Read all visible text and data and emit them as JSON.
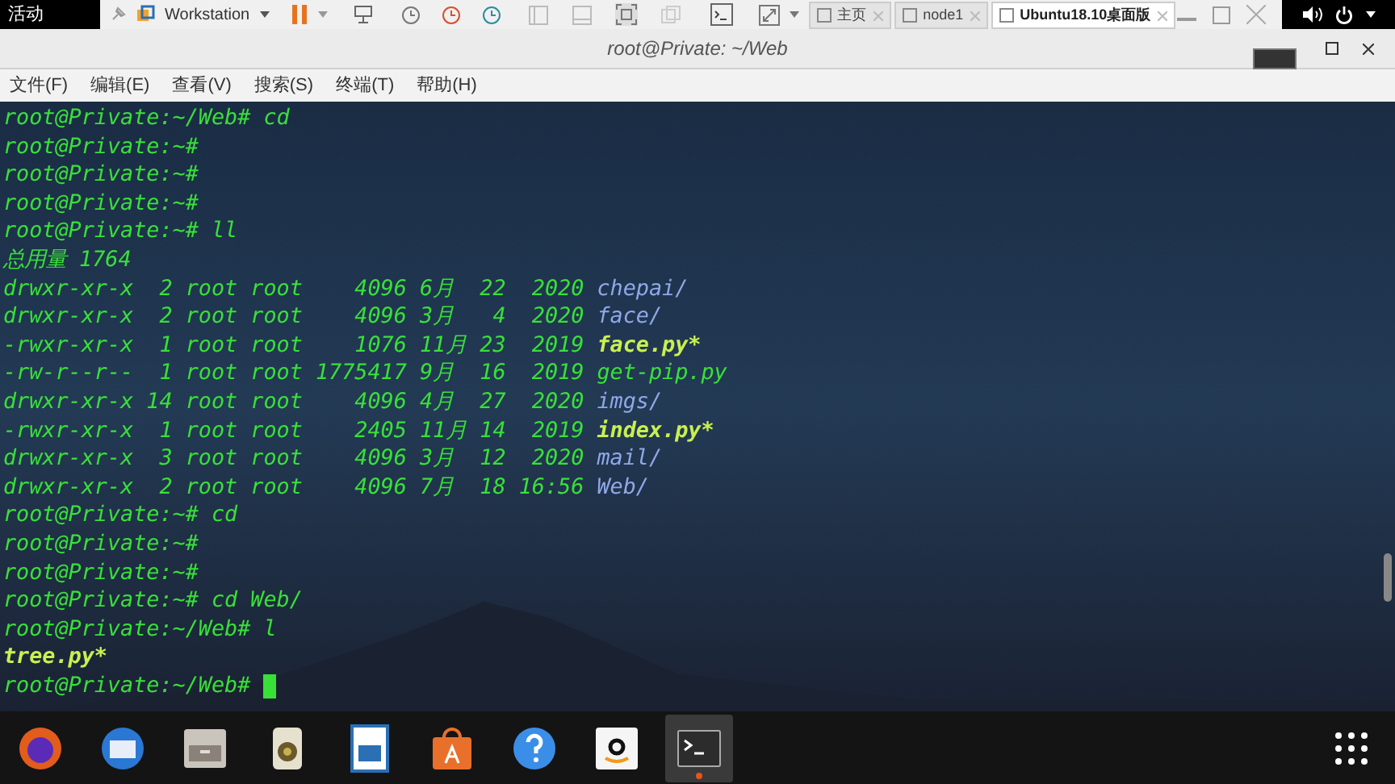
{
  "top_bar": {
    "activities": "活动"
  },
  "vm_toolbar": {
    "product": "Workstation",
    "tabs": [
      {
        "label": "主页",
        "selected": false
      },
      {
        "label": "node1",
        "selected": false
      },
      {
        "label": "Ubuntu18.10桌面版",
        "selected": true
      }
    ]
  },
  "window": {
    "title": "root@Private: ~/Web"
  },
  "menu": [
    "文件(F)",
    "编辑(E)",
    "查看(V)",
    "搜索(S)",
    "终端(T)",
    "帮助(H)"
  ],
  "terminal": {
    "lines": [
      [
        {
          "kind": "text",
          "text": "root@Private:~/Web# cd"
        }
      ],
      [
        {
          "kind": "text",
          "text": "root@Private:~#"
        }
      ],
      [
        {
          "kind": "text",
          "text": "root@Private:~#"
        }
      ],
      [
        {
          "kind": "text",
          "text": "root@Private:~#"
        }
      ],
      [
        {
          "kind": "text",
          "text": "root@Private:~# ll"
        }
      ],
      [
        {
          "kind": "text",
          "text": "总用量 1764"
        }
      ],
      [
        {
          "kind": "text",
          "text": "drwxr-xr-x  2 root root    4096 6月  22  2020 "
        },
        {
          "kind": "dir",
          "text": "chepai/"
        }
      ],
      [
        {
          "kind": "text",
          "text": "drwxr-xr-x  2 root root    4096 3月   4  2020 "
        },
        {
          "kind": "dir",
          "text": "face/"
        }
      ],
      [
        {
          "kind": "text",
          "text": "-rwxr-xr-x  1 root root    1076 11月 23  2019 "
        },
        {
          "kind": "exec",
          "text": "face.py*"
        }
      ],
      [
        {
          "kind": "text",
          "text": "-rw-r--r--  1 root root 1775417 9月  16  2019 get-pip.py"
        }
      ],
      [
        {
          "kind": "text",
          "text": "drwxr-xr-x 14 root root    4096 4月  27  2020 "
        },
        {
          "kind": "dir",
          "text": "imgs/"
        }
      ],
      [
        {
          "kind": "text",
          "text": "-rwxr-xr-x  1 root root    2405 11月 14  2019 "
        },
        {
          "kind": "exec",
          "text": "index.py*"
        }
      ],
      [
        {
          "kind": "text",
          "text": "drwxr-xr-x  3 root root    4096 3月  12  2020 "
        },
        {
          "kind": "dir",
          "text": "mail/"
        }
      ],
      [
        {
          "kind": "text",
          "text": "drwxr-xr-x  2 root root    4096 7月  18 16:56 "
        },
        {
          "kind": "dir",
          "text": "Web/"
        }
      ],
      [
        {
          "kind": "text",
          "text": "root@Private:~# cd"
        }
      ],
      [
        {
          "kind": "text",
          "text": "root@Private:~#"
        }
      ],
      [
        {
          "kind": "text",
          "text": "root@Private:~#"
        }
      ],
      [
        {
          "kind": "text",
          "text": "root@Private:~# cd Web/"
        }
      ],
      [
        {
          "kind": "text",
          "text": "root@Private:~/Web# l"
        }
      ],
      [
        {
          "kind": "exec",
          "text": "tree.py*"
        }
      ],
      [
        {
          "kind": "text",
          "text": "root@Private:~/Web# "
        },
        {
          "kind": "cursor"
        }
      ]
    ]
  },
  "dock": [
    {
      "kind": "browser",
      "running": false
    },
    {
      "kind": "mail",
      "running": false
    },
    {
      "kind": "files",
      "running": false
    },
    {
      "kind": "speaker",
      "running": false
    },
    {
      "kind": "document",
      "running": false
    },
    {
      "kind": "store",
      "running": false
    },
    {
      "kind": "help",
      "running": false
    },
    {
      "kind": "shop",
      "running": false
    },
    {
      "kind": "terminal",
      "running": true
    }
  ]
}
